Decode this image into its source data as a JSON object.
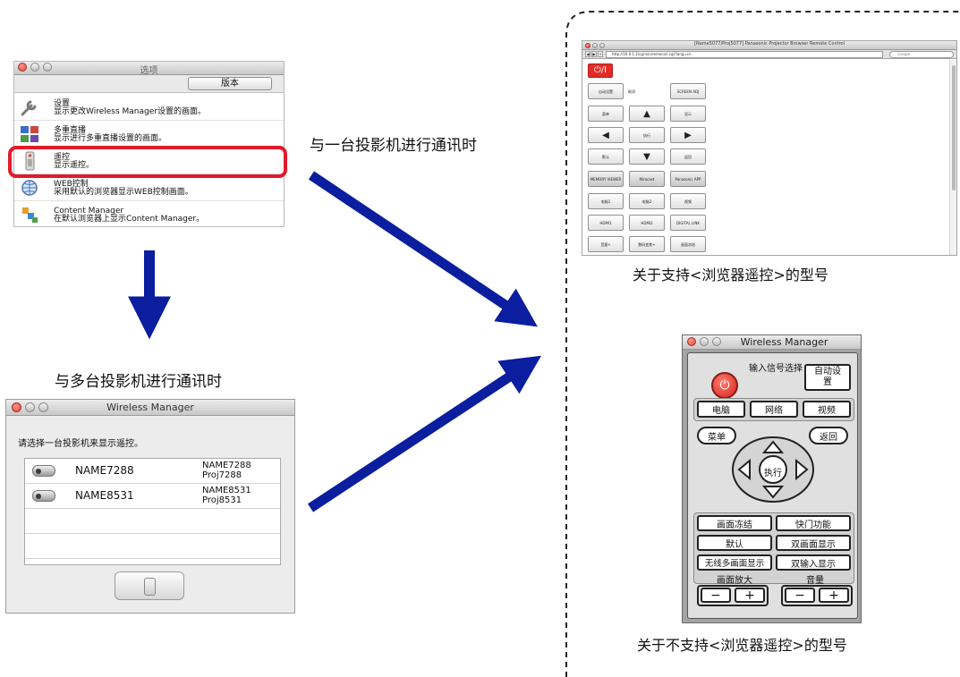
{
  "options_window": {
    "title": "选项",
    "version_button": "版本",
    "items": [
      {
        "title": "设置",
        "desc": "显示更改Wireless Manager设置的画面。",
        "icon": "wrench-icon"
      },
      {
        "title": "多重直播",
        "desc": "显示进行多重直播设置的画面。",
        "icon": "multi-screen-icon"
      },
      {
        "title": "遥控",
        "desc": "显示遥控。",
        "icon": "remote-icon"
      },
      {
        "title": "WEB控制",
        "desc": "采用默认的浏览器显示WEB控制画面。",
        "icon": "globe-icon"
      },
      {
        "title": "Content Manager",
        "desc": "在默认浏览器上显示Content Manager。",
        "icon": "content-manager-icon"
      }
    ]
  },
  "labels": {
    "single": "与一台投影机进行通讯时",
    "multi": "与多台投影机进行通讯时",
    "supported": "关于支持<浏览器遥控>的型号",
    "unsupported": "关于不支持<浏览器遥控>的型号"
  },
  "wm_list": {
    "title": "Wireless Manager",
    "prompt": "请选择一台投影机来显示遥控。",
    "rows": [
      {
        "name": "NAME7288",
        "right1": "NAME7288",
        "right2": "Proj7288"
      },
      {
        "name": "NAME8531",
        "right1": "NAME8531",
        "right2": "Proj8531"
      }
    ]
  },
  "browser": {
    "title": "[Name5077/Proj5077] Panasonic Projector Browser Remote Control",
    "url": "http://10.0.1.2/cgi-bin/remocon.cgi?lang=cn",
    "search": "Google",
    "power": "⏻/I",
    "buttons": {
      "auto": "自动设置",
      "input": "取消",
      "screen_adj": "SCREEN ADJ",
      "menu": "菜单",
      "up": "▲",
      "info": "显示",
      "left": "◀",
      "enter": "执行",
      "right": "▶",
      "default": "默认",
      "down": "▼",
      "return": "返回",
      "memory_viewer": "MEMORY VIEWER",
      "miracast": "Miracast",
      "panasonic_app": "Panasonic APP",
      "pc1": "电脑1",
      "pc2": "电脑2",
      "video": "视频",
      "hdmi1": "HDMI1",
      "hdmi2": "HDMI2",
      "digital_link": "DIGITAL LINK",
      "vol": "音量+",
      "zoom": "数码变焦+",
      "freeze": "画面冻结"
    }
  },
  "remote": {
    "title": "Wireless Manager",
    "input_select": "输入信号选择",
    "auto_setup": "自动设置",
    "pc": "电脑",
    "network": "网络",
    "video": "视频",
    "menu": "菜单",
    "return": "返回",
    "enter": "执行",
    "freeze": "画面冻结",
    "shutter": "快门功能",
    "default": "默认",
    "dual_screen": "双画面显示",
    "wireless_multi": "无线多画面显示",
    "dual_input": "双输入显示",
    "zoom": "画面放大",
    "volume": "音量",
    "minus": "−",
    "plus": "+"
  },
  "colors": {
    "highlight": "#e01b2a",
    "arrow": "#0a1e9f",
    "power": "#e32c25"
  }
}
